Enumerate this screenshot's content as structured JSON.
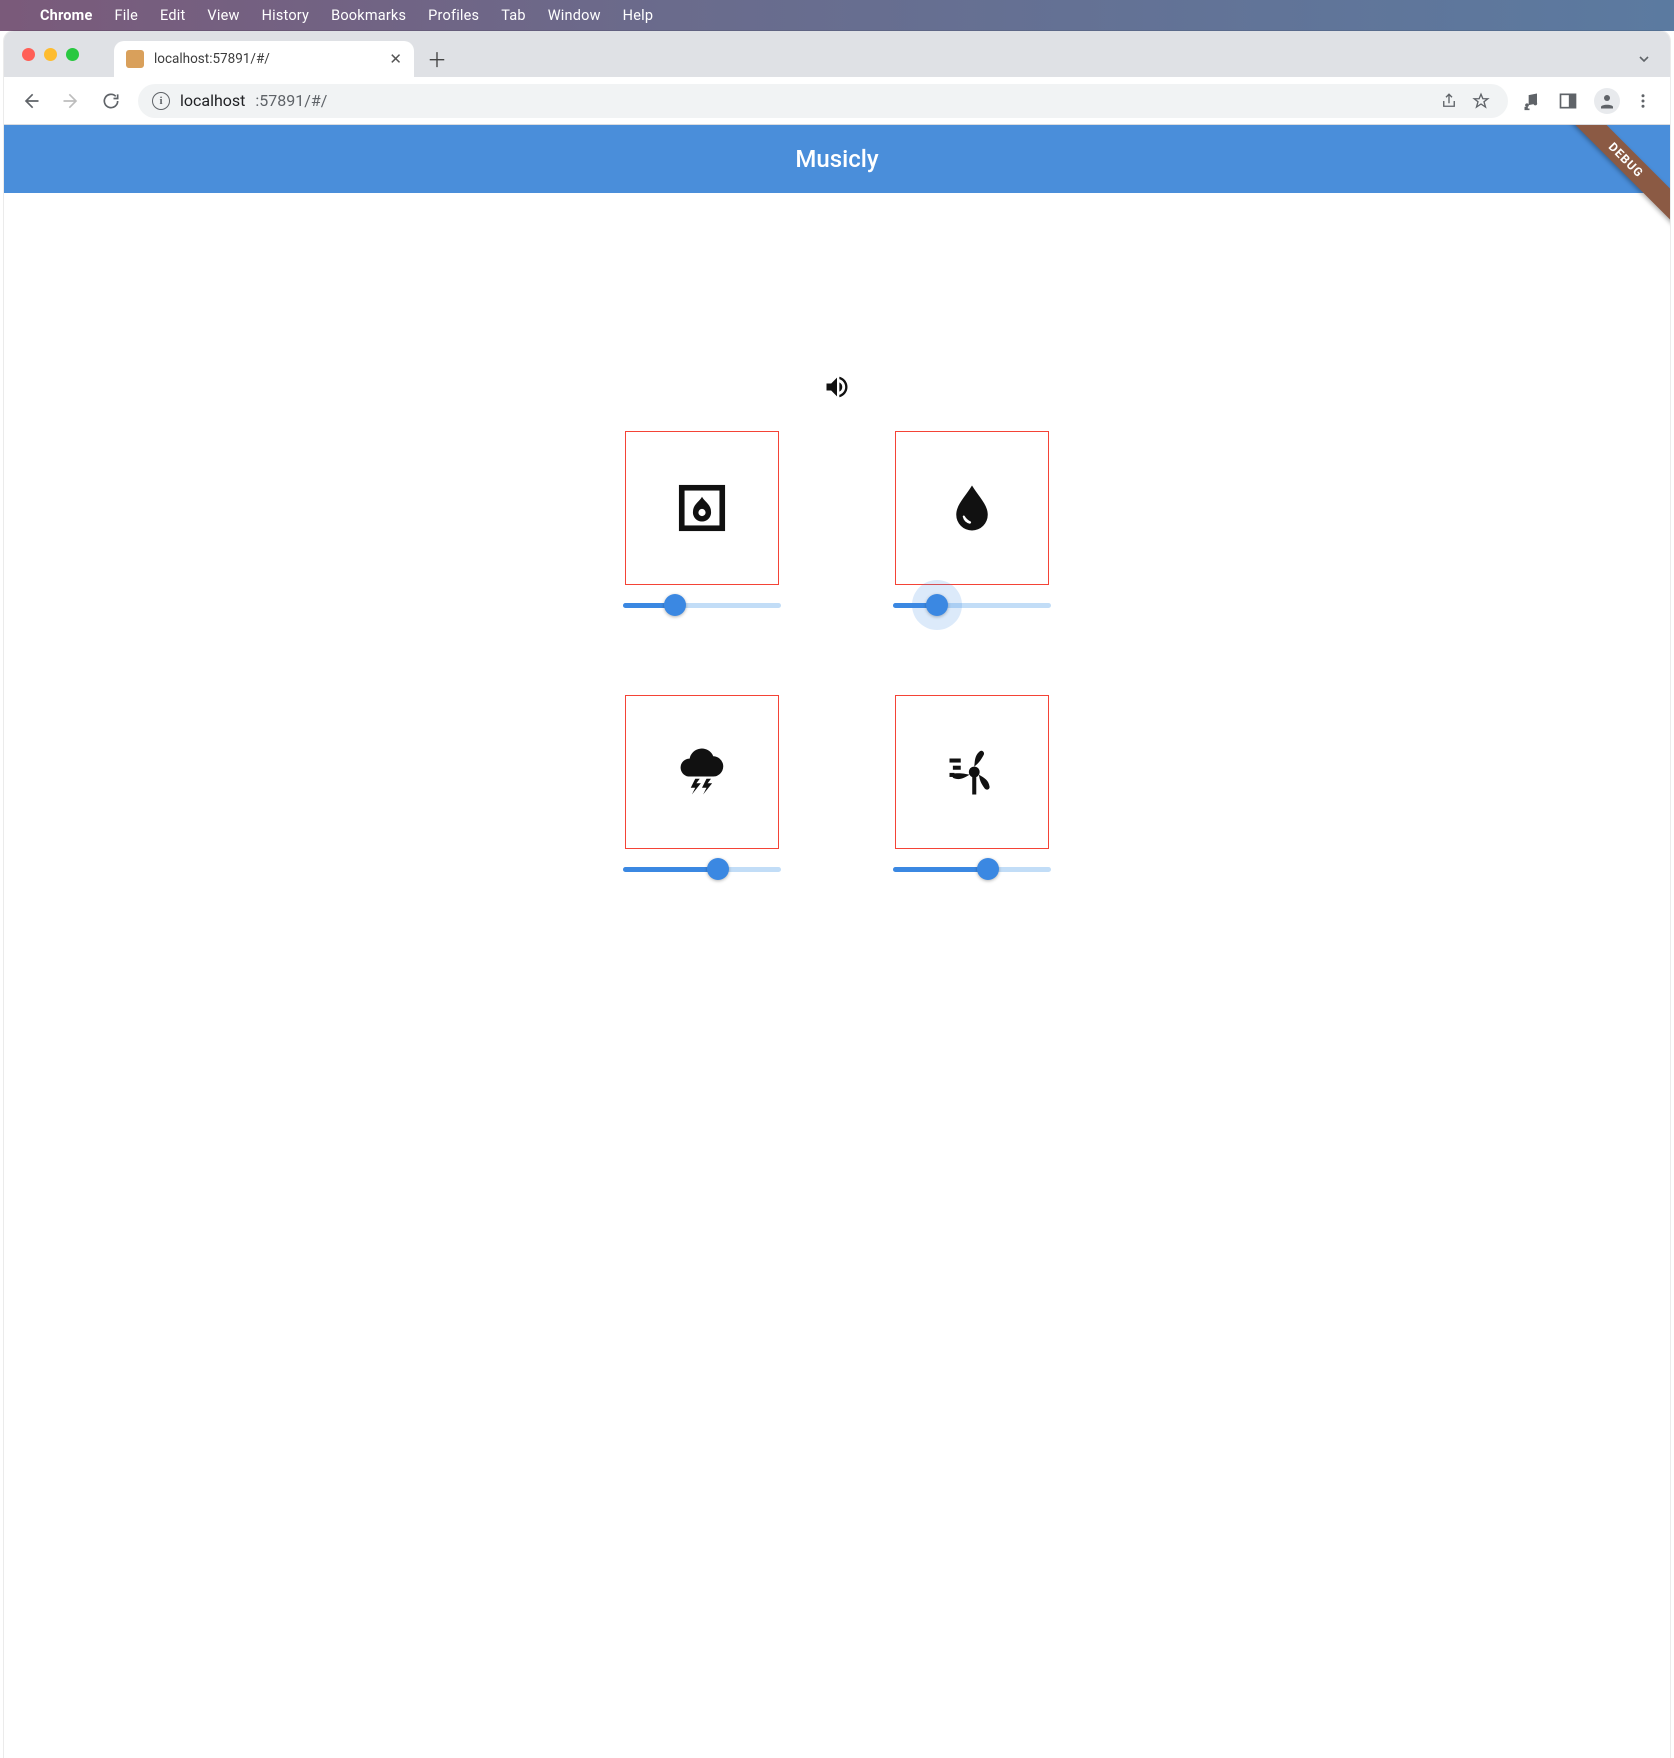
{
  "mac_menu": {
    "app": "Chrome",
    "items": [
      "File",
      "Edit",
      "View",
      "History",
      "Bookmarks",
      "Profiles",
      "Tab",
      "Window",
      "Help"
    ]
  },
  "browser": {
    "tab_title": "localhost:57891/#/",
    "url_host": "localhost",
    "url_path": ":57891/#/"
  },
  "app": {
    "title": "Musicly",
    "debug_label": "DEBUG",
    "sounds": [
      {
        "name": "fireplace",
        "icon": "fireplace-icon",
        "volume_percent": 33,
        "halo": false
      },
      {
        "name": "water",
        "icon": "water-drop-icon",
        "volume_percent": 28,
        "halo": true
      },
      {
        "name": "storm",
        "icon": "storm-icon",
        "volume_percent": 60,
        "halo": false
      },
      {
        "name": "wind",
        "icon": "wind-turbine-icon",
        "volume_percent": 60,
        "halo": false
      }
    ]
  }
}
